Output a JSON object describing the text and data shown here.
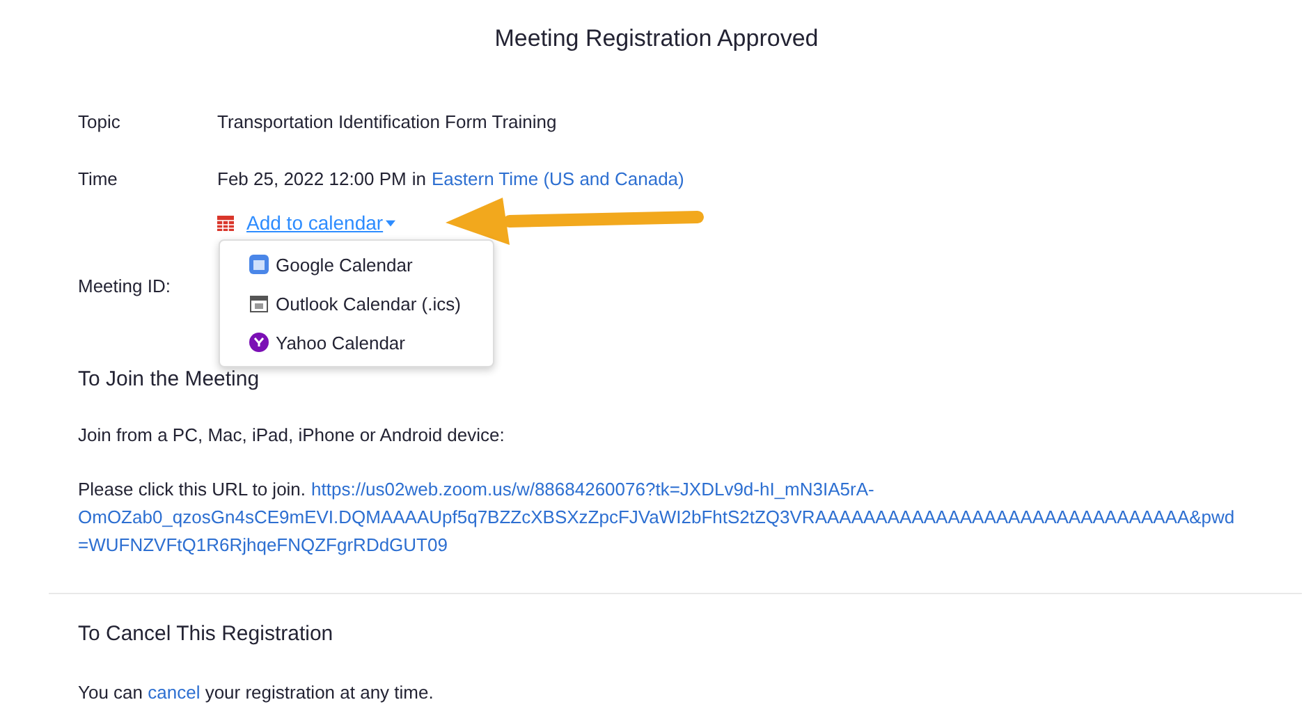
{
  "title": "Meeting Registration Approved",
  "details": [
    {
      "label": "Topic",
      "value": "Transportation Identification Form Training"
    },
    {
      "label": "Time",
      "value": "Feb 25, 2022 12:00 PM",
      "joiner": "in",
      "link": "Eastern Time (US and Canada)"
    }
  ],
  "add_to_calendar": {
    "label": "Add to calendar",
    "expanded": true,
    "options": [
      {
        "label": "Google Calendar",
        "kind": "google"
      },
      {
        "label": "Outlook Calendar (.ics)",
        "kind": "outlook"
      },
      {
        "label": "Yahoo Calendar",
        "kind": "yahoo"
      }
    ]
  },
  "meeting_id": {
    "label": "Meeting ID:"
  },
  "join": {
    "heading": "To Join the Meeting",
    "devices": "Join from a PC, Mac, iPad, iPhone or Android device:",
    "prompt": "Please click this URL to join.",
    "url_lines": [
      "https://us02web.zoom.us/w/88684260076?tk=JXDLv9d-hI_mN3IA5rA-",
      "OmOZab0_qzosGn4sCE9mEVI.DQMAAAAUpf5q7BZZcXBSXzZpcFJVaWI2bFhtS2tZQ3VRAAAAAAAAAAAAAAAAAAAAAAAAAAAAAAA&pwd",
      "=WUFNZVFtQ1R6RjhqeFNQZFgrRDdGUT09"
    ]
  },
  "cancel": {
    "heading": "To Cancel This Registration",
    "before": "You can",
    "link": "cancel",
    "after": "your registration at any time."
  }
}
